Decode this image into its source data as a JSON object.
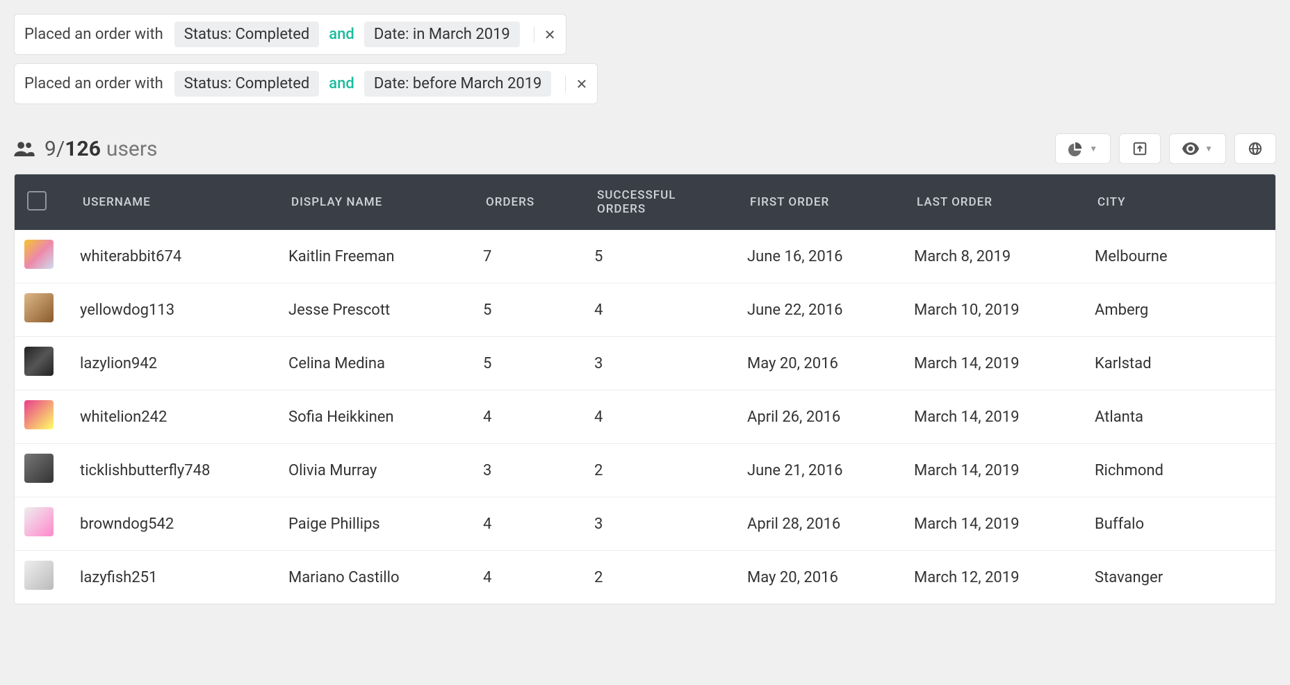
{
  "filters": [
    {
      "prefix": "Placed an order with",
      "tag1": "Status: Completed",
      "conj": "and",
      "tag2": "Date: in March 2019"
    },
    {
      "prefix": "Placed an order with",
      "tag1": "Status: Completed",
      "conj": "and",
      "tag2": "Date: before March 2019"
    }
  ],
  "results": {
    "shown": "9",
    "separator": " / ",
    "total": "126",
    "label": "users"
  },
  "columns": {
    "username": "USERNAME",
    "display_name": "DISPLAY NAME",
    "orders": "ORDERS",
    "successful_orders_l1": "SUCCESSFUL",
    "successful_orders_l2": "ORDERS",
    "first_order": "FIRST ORDER",
    "last_order": "LAST ORDER",
    "city": "CITY"
  },
  "rows": [
    {
      "username": "whiterabbit674",
      "display_name": "Kaitlin Freeman",
      "orders": "7",
      "successful": "5",
      "first": "June 16, 2016",
      "last": "March 8, 2019",
      "city": "Melbourne"
    },
    {
      "username": "yellowdog113",
      "display_name": "Jesse Prescott",
      "orders": "5",
      "successful": "4",
      "first": "June 22, 2016",
      "last": "March 10, 2019",
      "city": "Amberg"
    },
    {
      "username": "lazylion942",
      "display_name": "Celina Medina",
      "orders": "5",
      "successful": "3",
      "first": "May 20, 2016",
      "last": "March 14, 2019",
      "city": "Karlstad"
    },
    {
      "username": "whitelion242",
      "display_name": "Sofia Heikkinen",
      "orders": "4",
      "successful": "4",
      "first": "April 26, 2016",
      "last": "March 14, 2019",
      "city": "Atlanta"
    },
    {
      "username": "ticklishbutterfly748",
      "display_name": "Olivia Murray",
      "orders": "3",
      "successful": "2",
      "first": "June 21, 2016",
      "last": "March 14, 2019",
      "city": "Richmond"
    },
    {
      "username": "browndog542",
      "display_name": "Paige Phillips",
      "orders": "4",
      "successful": "3",
      "first": "April 28, 2016",
      "last": "March 14, 2019",
      "city": "Buffalo"
    },
    {
      "username": "lazyfish251",
      "display_name": "Mariano Castillo",
      "orders": "4",
      "successful": "2",
      "first": "May 20, 2016",
      "last": "March 12, 2019",
      "city": "Stavanger"
    }
  ]
}
